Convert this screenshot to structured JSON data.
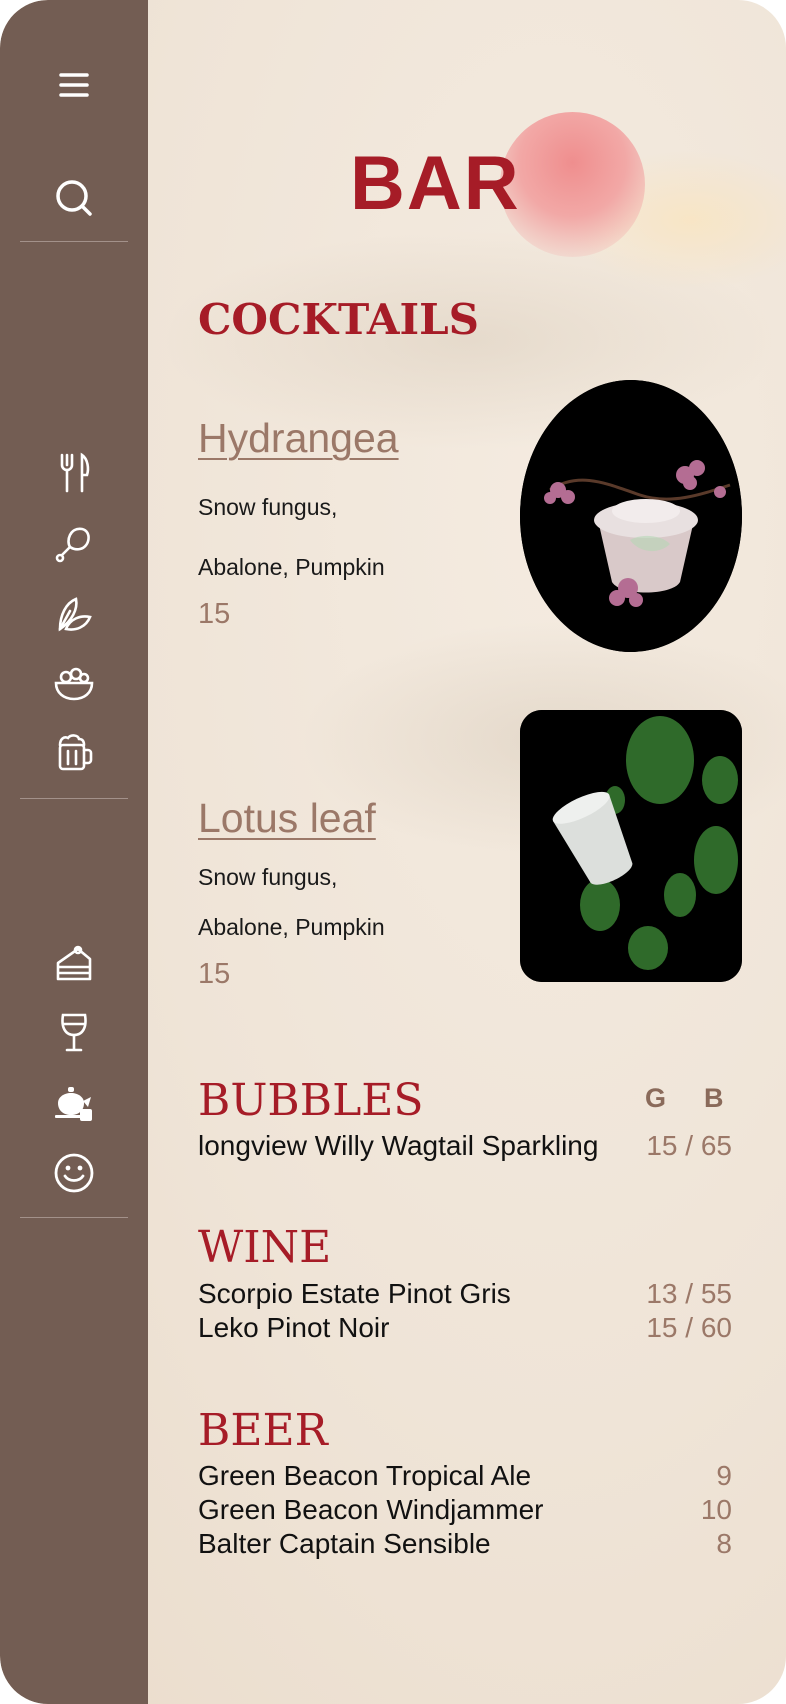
{
  "page": {
    "title": "BAR"
  },
  "sidebar": {
    "top_icons": [
      "menu-icon",
      "search-icon"
    ],
    "group1": [
      "fork-knife-icon",
      "drumstick-icon",
      "leaf-icon",
      "bowl-icon",
      "beer-mug-icon"
    ],
    "group2": [
      "cake-icon",
      "wine-glass-icon",
      "teapot-icon",
      "smiley-icon"
    ]
  },
  "cocktails": {
    "heading": "COCKTAILS",
    "items": [
      {
        "name": "Hydrangea",
        "desc1": "Snow fungus,",
        "desc2": "Abalone, Pumpkin",
        "price": "15"
      },
      {
        "name": "Lotus leaf",
        "desc1": "Snow fungus,",
        "desc2": "Abalone, Pumpkin",
        "price": "15"
      }
    ]
  },
  "bubbles": {
    "heading": "BUBBLES",
    "col_g": "G",
    "col_b": "B",
    "items": [
      {
        "name": "longview Willy Wagtail Sparkling",
        "price": "15 / 65"
      }
    ]
  },
  "wine": {
    "heading": "WINE",
    "items": [
      {
        "name": "Scorpio Estate Pinot Gris",
        "price": "13 / 55"
      },
      {
        "name": "Leko Pinot Noir",
        "price": "15 / 60"
      }
    ]
  },
  "beer": {
    "heading": "BEER",
    "items": [
      {
        "name": "Green Beacon Tropical Ale",
        "price": "9"
      },
      {
        "name": "Green Beacon Windjammer",
        "price": "10"
      },
      {
        "name": "Balter Captain Sensible",
        "price": "8"
      }
    ]
  },
  "colors": {
    "accent": "#a61c27",
    "sidebar": "#735d53",
    "muted": "#9b7868",
    "background": "#efe4d7"
  }
}
